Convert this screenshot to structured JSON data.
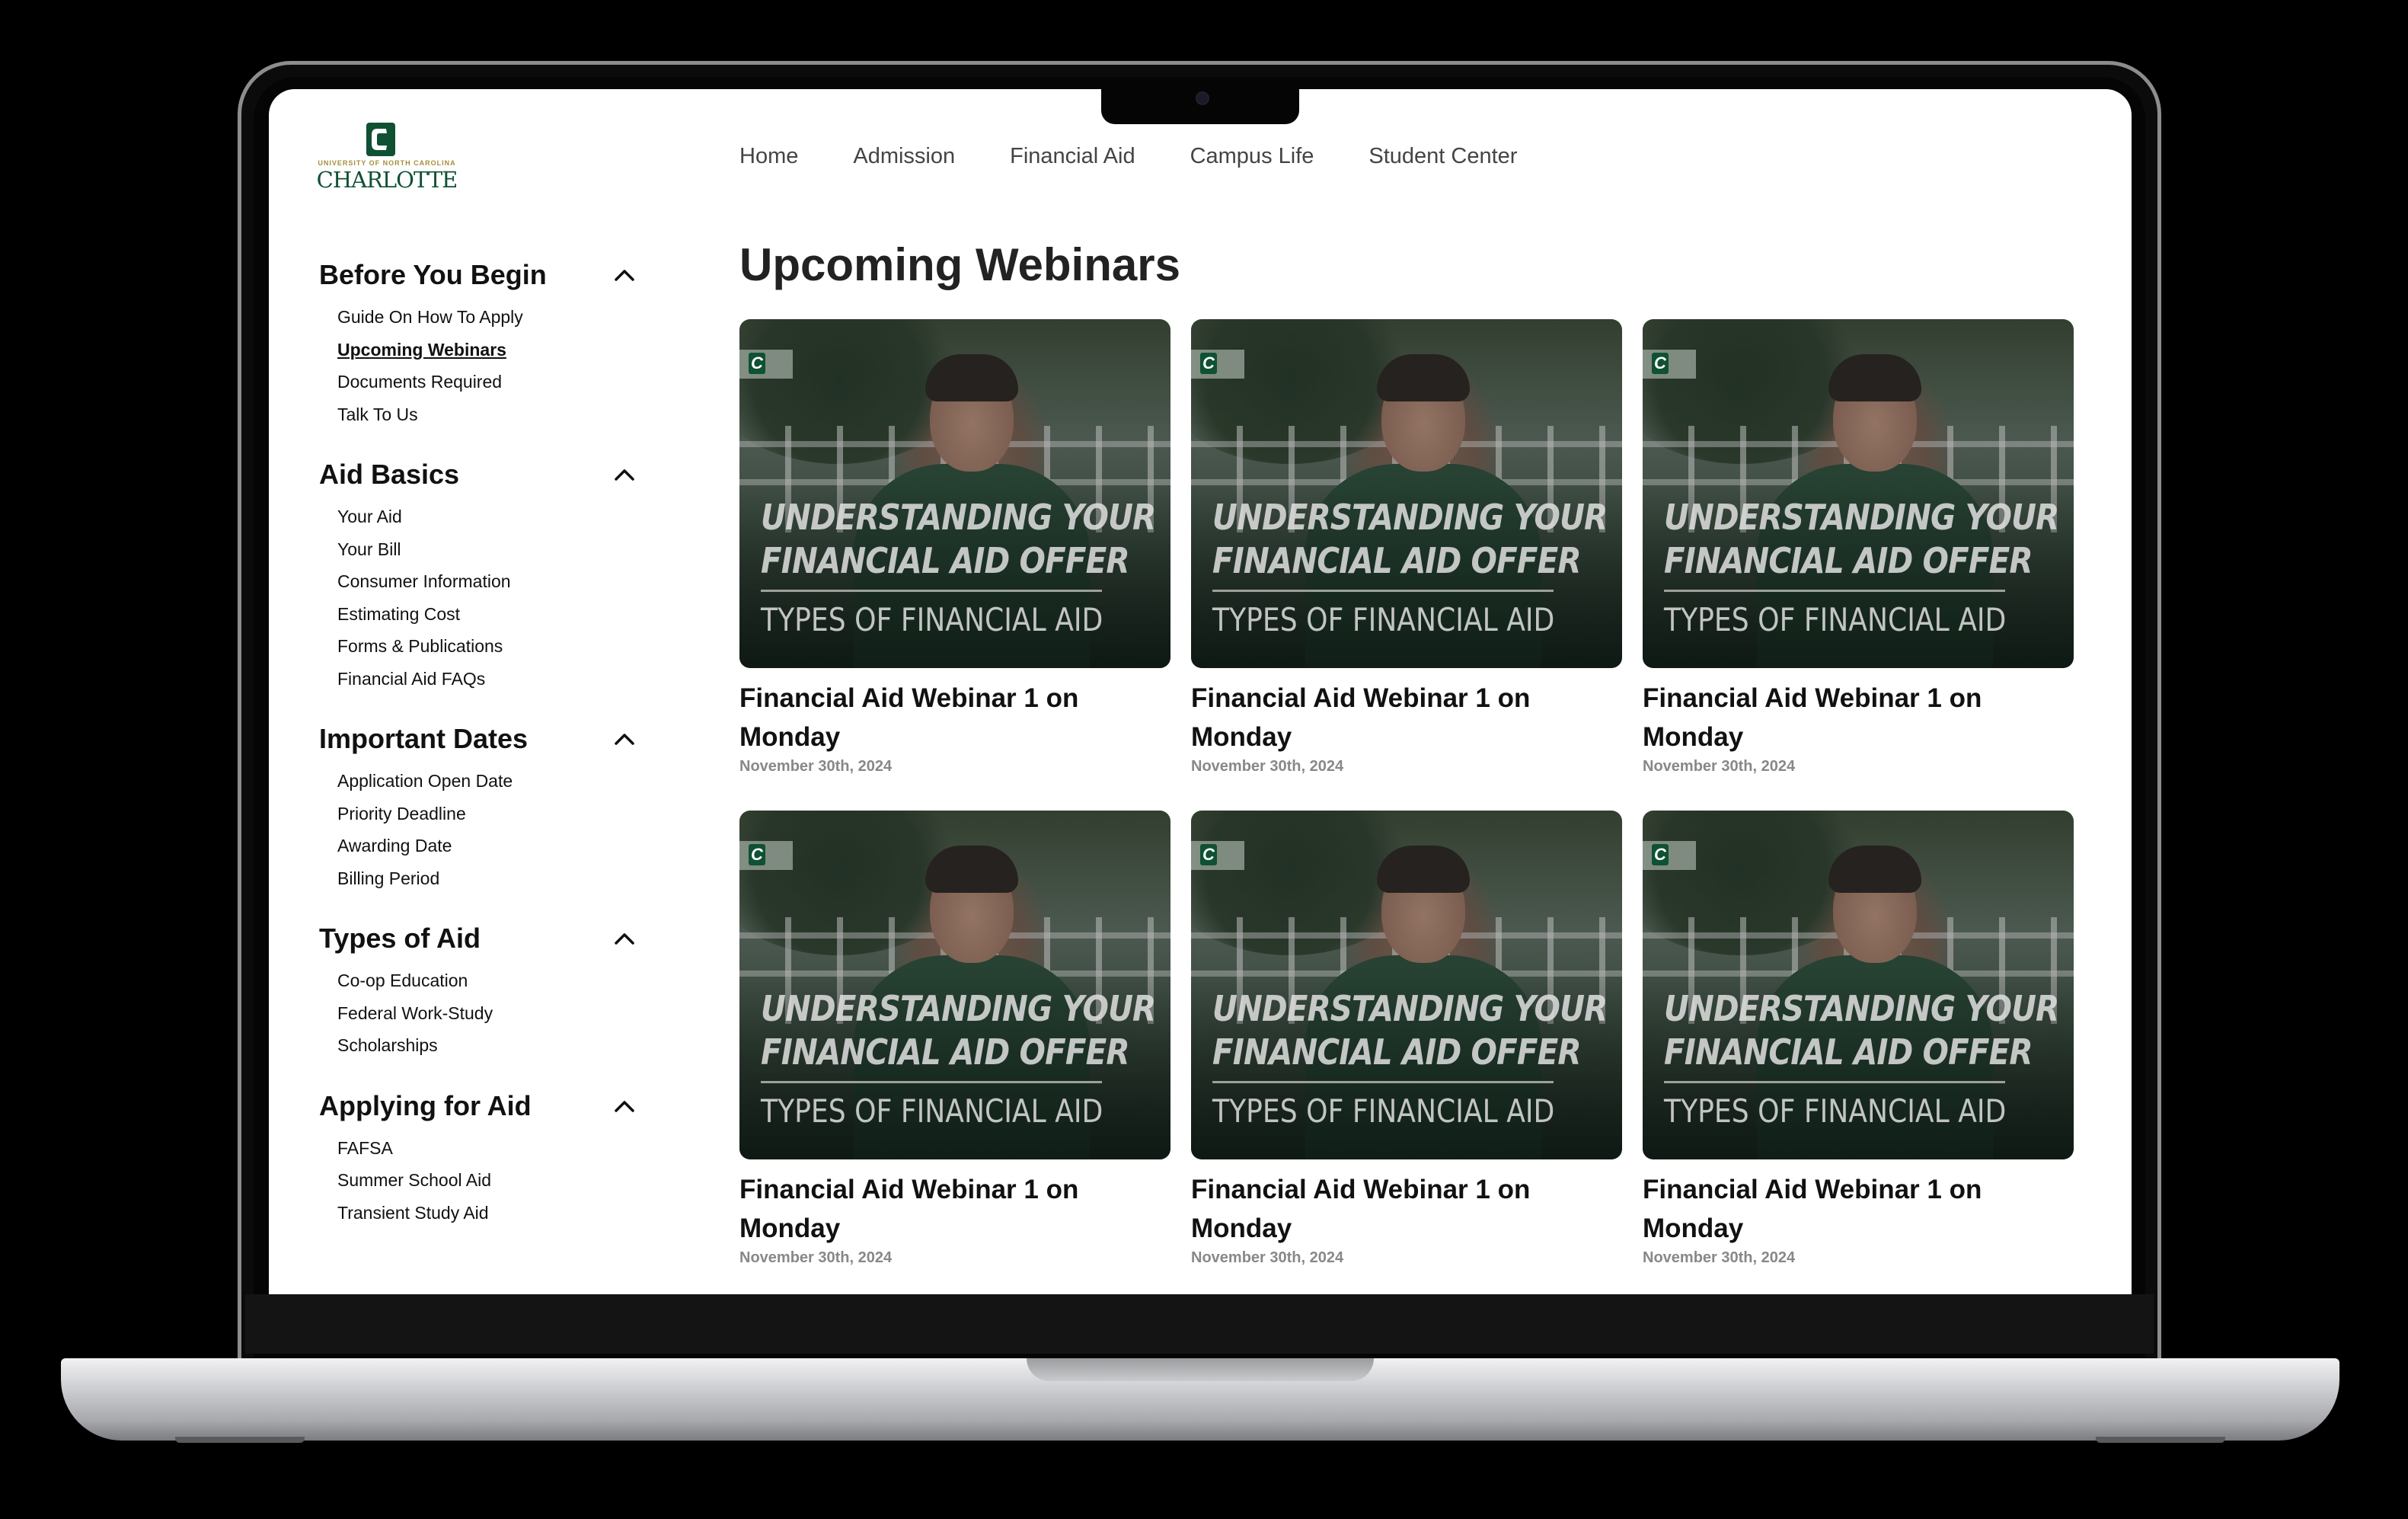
{
  "logo": {
    "subtitle": "UNIVERSITY OF NORTH CAROLINA",
    "name": "CHARLOTTE"
  },
  "nav": [
    "Home",
    "Admission",
    "Financial Aid",
    "Campus Life",
    "Student Center"
  ],
  "sidebar": [
    {
      "title": "Before You Begin",
      "items": [
        "Guide On How To Apply",
        "Upcoming Webinars",
        "Documents Required",
        "Talk To Us"
      ]
    },
    {
      "title": "Aid Basics",
      "items": [
        "Your Aid",
        "Your Bill",
        "Consumer Information",
        "Estimating Cost",
        "Forms & Publications",
        "Financial Aid FAQs"
      ]
    },
    {
      "title": "Important Dates",
      "items": [
        "Application Open Date",
        "Priority Deadline",
        "Awarding Date",
        "Billing Period"
      ]
    },
    {
      "title": "Types of Aid",
      "items": [
        "Co-op Education",
        "Federal Work-Study",
        "Scholarships"
      ]
    },
    {
      "title": "Applying for Aid",
      "items": [
        "FAFSA",
        "Summer School Aid",
        "Transient Study Aid"
      ]
    }
  ],
  "active_item": "Upcoming Webinars",
  "page_title": "Upcoming Webinars",
  "thumbnail": {
    "badge": "C",
    "headline_1": "UNDERSTANDING YOUR",
    "headline_2": "FINANCIAL AID OFFER",
    "subline": "TYPES OF FINANCIAL AID"
  },
  "webinars": [
    {
      "title": "Financial Aid Webinar 1 on Monday",
      "date": "November 30th, 2024"
    },
    {
      "title": "Financial Aid Webinar 1 on Monday",
      "date": "November 30th, 2024"
    },
    {
      "title": "Financial Aid Webinar 1 on Monday",
      "date": "November 30th, 2024"
    },
    {
      "title": "Financial Aid Webinar 1 on Monday",
      "date": "November 30th, 2024"
    },
    {
      "title": "Financial Aid Webinar 1 on Monday",
      "date": "November 30th, 2024"
    },
    {
      "title": "Financial Aid Webinar 1 on Monday",
      "date": "November 30th, 2024"
    }
  ],
  "colors": {
    "brand_green": "#0f5132",
    "brand_gold": "#a58e3a",
    "text": "#111111",
    "date": "#888888"
  }
}
